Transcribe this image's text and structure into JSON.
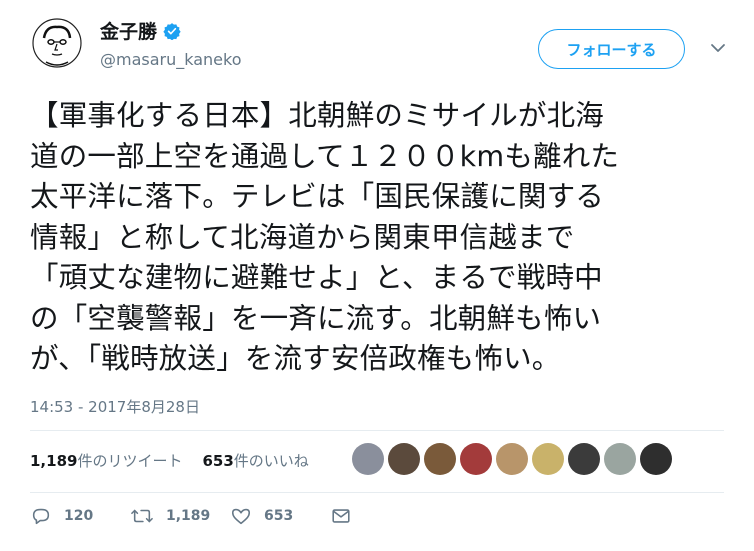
{
  "user": {
    "display_name": "金子勝",
    "handle": "@masaru_kaneko",
    "verified_icon": "verified-badge-icon"
  },
  "follow_button": {
    "label": "フォローする"
  },
  "tweet": {
    "lines": [
      "【軍事化する日本】北朝鮮のミサイルが北海",
      "道の一部上空を通過して１２００kmも離れた",
      "太平洋に落下。テレビは「国民保護に関する",
      "情報」と称して北海道から関東甲信越まで",
      "「頑丈な建物に避難せよ」と、まるで戦時中",
      "の「空襲警報」を一斉に流す。北朝鮮も怖い",
      "が、「戦時放送」を流す安倍政権も怖い。"
    ],
    "timestamp": "14:53 - 2017年8月28日"
  },
  "stats": {
    "retweets_count": "1,189",
    "retweets_label": "件のリツイート",
    "likes_count": "653",
    "likes_label": "件のいいね"
  },
  "likers": [
    {
      "color": "#8a8f9c"
    },
    {
      "color": "#5b4a3c"
    },
    {
      "color": "#7a5a3a"
    },
    {
      "color": "#a33b3b"
    },
    {
      "color": "#b8956a"
    },
    {
      "color": "#c9b26a"
    },
    {
      "color": "#3b3b3b"
    },
    {
      "color": "#9aa5a0"
    },
    {
      "color": "#2e2e2e"
    }
  ],
  "actions": {
    "reply_count": "120",
    "retweet_count": "1,189",
    "like_count": "653"
  },
  "colors": {
    "accent": "#1da1f2",
    "secondary_text": "#657786",
    "primary_text": "#14171a"
  }
}
